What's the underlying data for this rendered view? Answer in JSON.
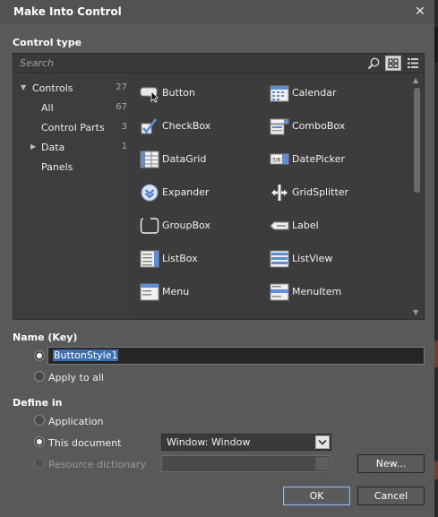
{
  "dialog": {
    "title": "Make Into Control",
    "close_glyph": "✕"
  },
  "control_type": {
    "label": "Control type",
    "search_placeholder": "Search",
    "tree": [
      {
        "label": "Controls",
        "count": "27",
        "expandable": true,
        "expanded": true
      },
      {
        "label": "All",
        "count": "67"
      },
      {
        "label": "Control Parts",
        "count": "3"
      },
      {
        "label": "Data",
        "count": "1",
        "expandable": true,
        "expanded": false
      },
      {
        "label": "Panels",
        "count": ""
      }
    ],
    "grid_items": [
      {
        "label": "Button",
        "icon": "button-icon"
      },
      {
        "label": "Calendar",
        "icon": "calendar-icon"
      },
      {
        "label": "CheckBox",
        "icon": "checkbox-icon"
      },
      {
        "label": "ComboBox",
        "icon": "combobox-icon"
      },
      {
        "label": "DataGrid",
        "icon": "datagrid-icon"
      },
      {
        "label": "DatePicker",
        "icon": "datepicker-icon"
      },
      {
        "label": "Expander",
        "icon": "expander-icon"
      },
      {
        "label": "GridSplitter",
        "icon": "gridsplitter-icon"
      },
      {
        "label": "GroupBox",
        "icon": "groupbox-icon"
      },
      {
        "label": "Label",
        "icon": "label-icon"
      },
      {
        "label": "ListBox",
        "icon": "listbox-icon"
      },
      {
        "label": "ListView",
        "icon": "listview-icon"
      },
      {
        "label": "Menu",
        "icon": "menu-icon"
      },
      {
        "label": "MenuItem",
        "icon": "menuitem-icon"
      }
    ],
    "datepicker_icon_text": "3/8"
  },
  "name_key": {
    "label": "Name (Key)",
    "value": "ButtonStyle1",
    "apply_to_all": "Apply to all"
  },
  "define_in": {
    "label": "Define in",
    "application": "Application",
    "this_document": "This document",
    "this_document_selected": "Window: Window",
    "resource_dictionary": "Resource dictionary",
    "new_button": "New..."
  },
  "buttons": {
    "ok": "OK",
    "cancel": "Cancel"
  },
  "colors": {
    "background": "#595959",
    "panel": "#3c3c3c",
    "selection": "#3b6fb4",
    "icon_blue": "#5b8ed6"
  }
}
